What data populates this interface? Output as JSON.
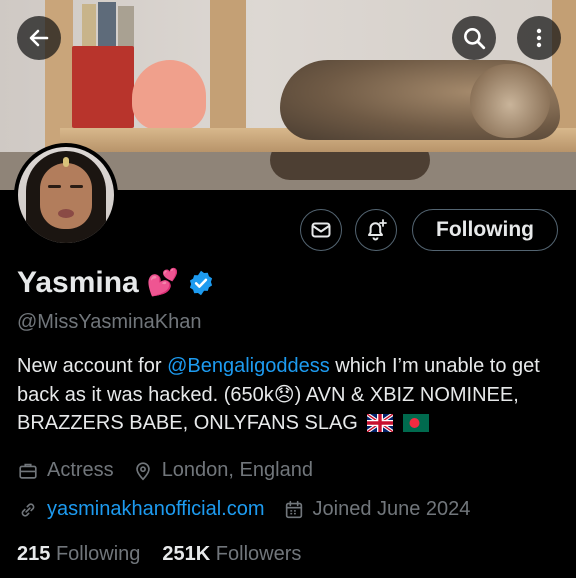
{
  "header": {
    "back_icon": "arrow-left-icon",
    "search_icon": "search-icon",
    "more_icon": "more-vertical-icon"
  },
  "actions": {
    "message_icon": "envelope-icon",
    "notify_icon": "bell-plus-icon",
    "follow_label": "Following"
  },
  "profile": {
    "name": "Yasmina",
    "name_emoji": "💕",
    "verified_color": "#1d9bf0",
    "handle": "@MissYasminaKhan",
    "bio": {
      "part1": "New account for ",
      "mention": "@Bengaligoddess",
      "part2": " which I’m unable to get back as it was hacked. (650k",
      "sad_emoji": "😞",
      "part3": ") AVN & XBIZ NOMINEE, BRAZZERS BABE, ONLYFANS SLAG"
    },
    "occupation": "Actress",
    "location": "London, England",
    "website": "yasminakhanofficial.com",
    "joined": "Joined June 2024"
  },
  "stats": {
    "following_count": "215",
    "following_label": "Following",
    "followers_count": "251K",
    "followers_label": "Followers"
  },
  "colors": {
    "accent": "#1d9bf0",
    "muted": "#71767b",
    "text": "#e7e9ea",
    "border": "#536471"
  }
}
